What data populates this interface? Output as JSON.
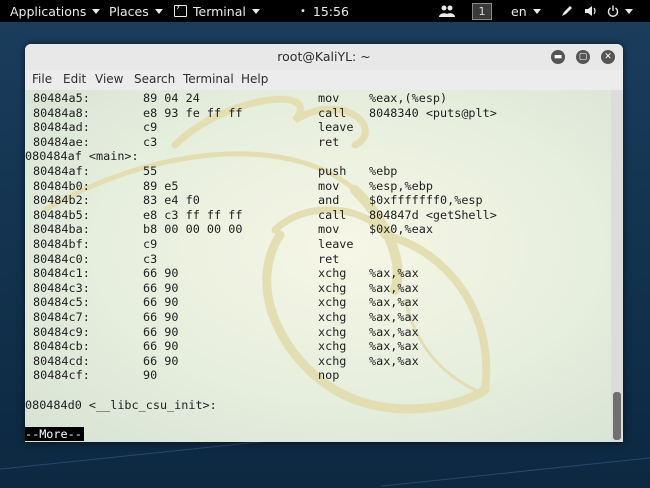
{
  "topbar": {
    "applications": "Applications",
    "places": "Places",
    "terminal": "Terminal",
    "clock": "15:56",
    "workspace": "1",
    "language": "en",
    "icons": [
      "people-icon",
      "pen-icon",
      "volume-icon",
      "power-icon"
    ]
  },
  "window": {
    "title": "root@KaliYL: ~",
    "menu": [
      "File",
      "Edit",
      "View",
      "Search",
      "Terminal",
      "Help"
    ]
  },
  "terminal": {
    "lines": [
      {
        "addr": "80484a5:",
        "bytes": "89 04 24",
        "mn": "mov",
        "op": "%eax,(%esp)"
      },
      {
        "addr": "80484a8:",
        "bytes": "e8 93 fe ff ff",
        "mn": "call",
        "op": "8048340 <puts@plt>"
      },
      {
        "addr": "80484ad:",
        "bytes": "c9",
        "mn": "leave",
        "op": ""
      },
      {
        "addr": "80484ae:",
        "bytes": "c3",
        "mn": "ret",
        "op": ""
      },
      {
        "label": "080484af <main>:"
      },
      {
        "addr": "80484af:",
        "bytes": "55",
        "mn": "push",
        "op": "%ebp"
      },
      {
        "addr": "80484b0:",
        "bytes": "89 e5",
        "mn": "mov",
        "op": "%esp,%ebp"
      },
      {
        "addr": "80484b2:",
        "bytes": "83 e4 f0",
        "mn": "and",
        "op": "$0xfffffff0,%esp"
      },
      {
        "addr": "80484b5:",
        "bytes": "e8 c3 ff ff ff",
        "mn": "call",
        "op": "804847d <getShell>"
      },
      {
        "addr": "80484ba:",
        "bytes": "b8 00 00 00 00",
        "mn": "mov",
        "op": "$0x0,%eax"
      },
      {
        "addr": "80484bf:",
        "bytes": "c9",
        "mn": "leave",
        "op": ""
      },
      {
        "addr": "80484c0:",
        "bytes": "c3",
        "mn": "ret",
        "op": ""
      },
      {
        "addr": "80484c1:",
        "bytes": "66 90",
        "mn": "xchg",
        "op": "%ax,%ax"
      },
      {
        "addr": "80484c3:",
        "bytes": "66 90",
        "mn": "xchg",
        "op": "%ax,%ax"
      },
      {
        "addr": "80484c5:",
        "bytes": "66 90",
        "mn": "xchg",
        "op": "%ax,%ax"
      },
      {
        "addr": "80484c7:",
        "bytes": "66 90",
        "mn": "xchg",
        "op": "%ax,%ax"
      },
      {
        "addr": "80484c9:",
        "bytes": "66 90",
        "mn": "xchg",
        "op": "%ax,%ax"
      },
      {
        "addr": "80484cb:",
        "bytes": "66 90",
        "mn": "xchg",
        "op": "%ax,%ax"
      },
      {
        "addr": "80484cd:",
        "bytes": "66 90",
        "mn": "xchg",
        "op": "%ax,%ax"
      },
      {
        "addr": "80484cf:",
        "bytes": "90",
        "mn": "nop",
        "op": ""
      },
      {
        "label": ""
      },
      {
        "label": "080484d0 <__libc_csu_init>:"
      }
    ],
    "pager_prompt": "--More--"
  },
  "colors": {
    "panel": "#000000",
    "terminal_text": "#1e1e1e",
    "desktop": "#143552"
  }
}
